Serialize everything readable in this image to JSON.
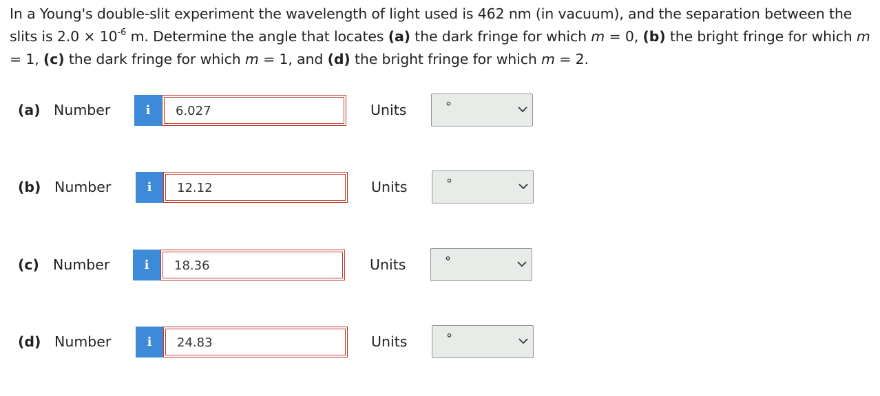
{
  "question": {
    "intro": "In a Young's double-slit experiment the wavelength of light used is 462 nm (in vacuum), and the separation between the slits is 2.0 × 10",
    "exponent": "-6",
    "after_exp": " m. Determine the angle that locates ",
    "a_tag": "(a)",
    "a_text": " the dark fringe for which ",
    "a_var": "m",
    "a_eq": " = 0, ",
    "b_tag": "(b)",
    "b_text": " the bright fringe for which ",
    "b_var": "m",
    "b_eq": " = 1, ",
    "c_tag": "(c)",
    "c_text": " the dark fringe for which ",
    "c_var": "m",
    "c_eq": " = 1, and ",
    "d_tag": "(d)",
    "d_text": " the bright fringe for which ",
    "d_var": "m",
    "d_eq": " = 2."
  },
  "rows": [
    {
      "part": "(a)",
      "number_label": "Number",
      "info_icon": "i",
      "value": "6.027",
      "units_label": "Units",
      "units_value": "°"
    },
    {
      "part": "(b)",
      "number_label": "Number",
      "info_icon": "i",
      "value": "12.12",
      "units_label": "Units",
      "units_value": "°"
    },
    {
      "part": "(c)",
      "number_label": "Number",
      "info_icon": "i",
      "value": "18.36",
      "units_label": "Units",
      "units_value": "°"
    },
    {
      "part": "(d)",
      "number_label": "Number",
      "info_icon": "i",
      "value": "24.83",
      "units_label": "Units",
      "units_value": "°"
    }
  ],
  "colors": {
    "info_button": "#3c8ad8",
    "answer_border": "#c0392b",
    "select_background": "#e8ece9"
  }
}
